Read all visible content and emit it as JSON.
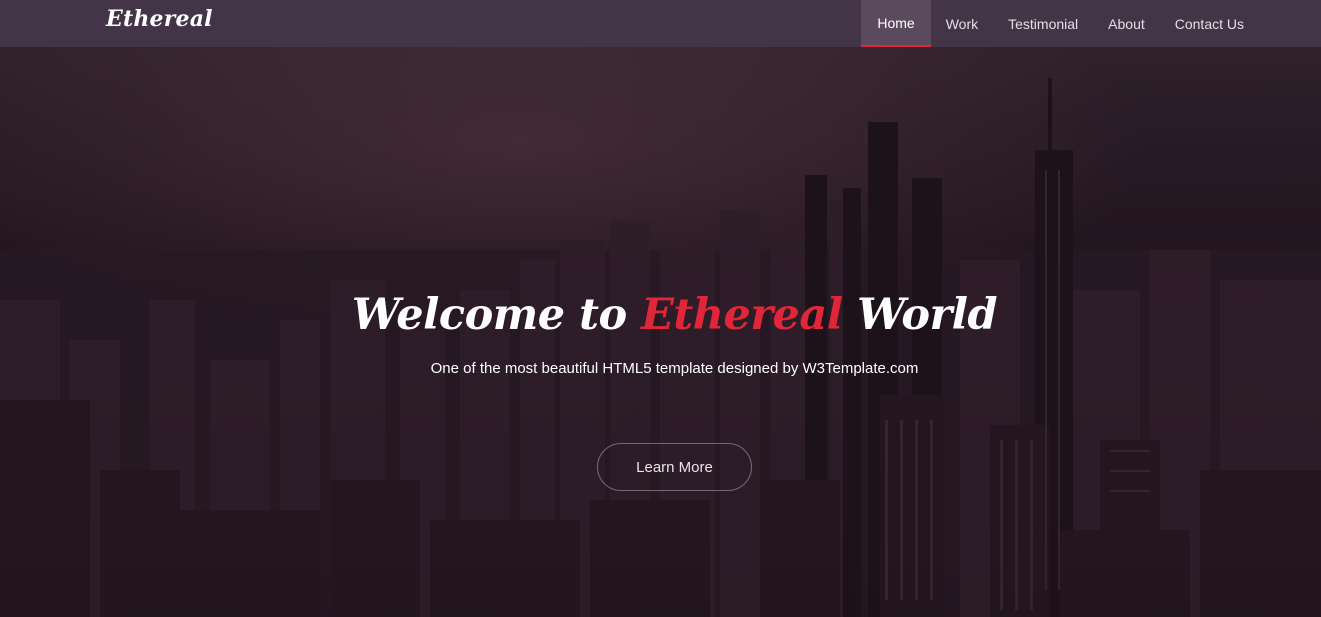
{
  "brand": {
    "name": "Ethereal"
  },
  "nav": {
    "items": [
      {
        "label": "Home",
        "active": true
      },
      {
        "label": "Work",
        "active": false
      },
      {
        "label": "Testimonial",
        "active": false
      },
      {
        "label": "About",
        "active": false
      },
      {
        "label": "Contact Us",
        "active": false
      }
    ]
  },
  "hero": {
    "title_before": "Welcome to ",
    "title_accent": "Ethereal",
    "title_after": " World",
    "subtitle": "One of the most beautiful HTML5 template designed by W3Template.com",
    "cta_label": "Learn More",
    "background_icon": "city-skyline-photo"
  },
  "colors": {
    "accent": "#e0273a",
    "navbar": "#443447",
    "nav_active": "#5b4a5e"
  }
}
